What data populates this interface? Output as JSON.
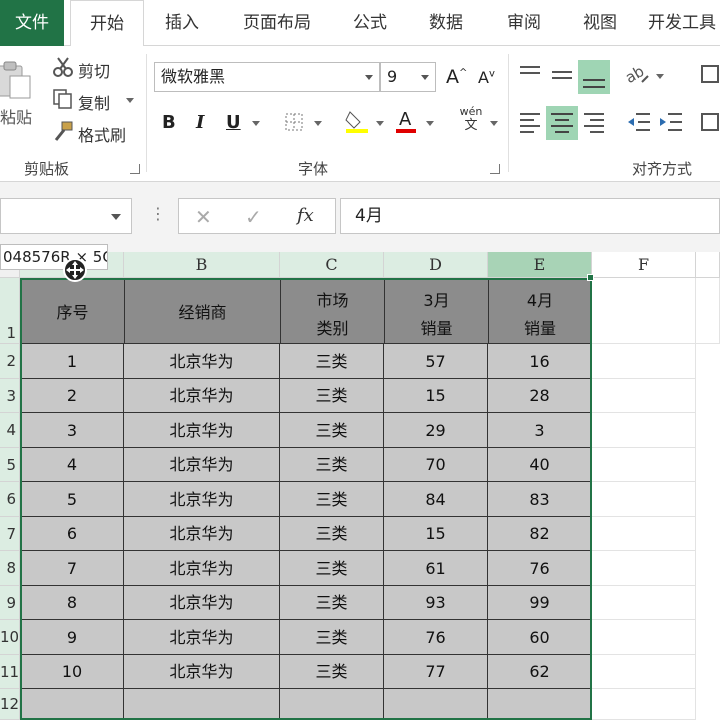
{
  "tabs": [
    {
      "label": "文件"
    },
    {
      "label": "开始"
    },
    {
      "label": "插入"
    },
    {
      "label": "页面布局"
    },
    {
      "label": "公式"
    },
    {
      "label": "数据"
    },
    {
      "label": "审阅"
    },
    {
      "label": "视图"
    },
    {
      "label": "开发工具"
    }
  ],
  "ribbon": {
    "clipboard": {
      "paste": "粘贴",
      "cut": "剪切",
      "copy": "复制",
      "format_painter": "格式刷",
      "group_label": "剪贴板"
    },
    "font": {
      "font_name": "微软雅黑",
      "font_size": "9",
      "grow": "A",
      "shrink": "A",
      "bold": "B",
      "italic": "I",
      "underline": "U",
      "fill_color": "#ffff00",
      "font_color": "#e00000",
      "phonetic": "wén",
      "phonetic_sub": "文",
      "group_label": "字体"
    },
    "alignment": {
      "group_label": "对齐方式"
    }
  },
  "formula_bar": {
    "name_box": "",
    "cancel": "✕",
    "enter": "✓",
    "fx": "fx",
    "value": "4月"
  },
  "name_tip": "048576R × 5C",
  "columns": [
    "B",
    "C",
    "D",
    "E",
    "F"
  ],
  "row_numbers": [
    "1",
    "2",
    "3",
    "4",
    "5",
    "6",
    "7",
    "8",
    "9",
    "10",
    "11",
    "12"
  ],
  "table": {
    "headers": [
      {
        "line1": "序号",
        "line2": ""
      },
      {
        "line1": "经销商",
        "line2": ""
      },
      {
        "line1": "市场",
        "line2": "类别"
      },
      {
        "line1": "3月",
        "line2": "销量"
      },
      {
        "line1": "4月",
        "line2": "销量"
      }
    ],
    "rows": [
      [
        "1",
        "北京华为",
        "三类",
        "57",
        "16"
      ],
      [
        "2",
        "北京华为",
        "三类",
        "15",
        "28"
      ],
      [
        "3",
        "北京华为",
        "三类",
        "29",
        "3"
      ],
      [
        "4",
        "北京华为",
        "三类",
        "70",
        "40"
      ],
      [
        "5",
        "北京华为",
        "三类",
        "84",
        "83"
      ],
      [
        "6",
        "北京华为",
        "三类",
        "15",
        "82"
      ],
      [
        "7",
        "北京华为",
        "三类",
        "61",
        "76"
      ],
      [
        "8",
        "北京华为",
        "三类",
        "93",
        "99"
      ],
      [
        "9",
        "北京华为",
        "三类",
        "76",
        "60"
      ],
      [
        "10",
        "北京华为",
        "三类",
        "77",
        "62"
      ]
    ]
  },
  "colors": {
    "accent": "#217346",
    "header_fill": "#8c8c8c",
    "data_fill": "#c8c8c8",
    "selected_header": "#dcede2"
  }
}
